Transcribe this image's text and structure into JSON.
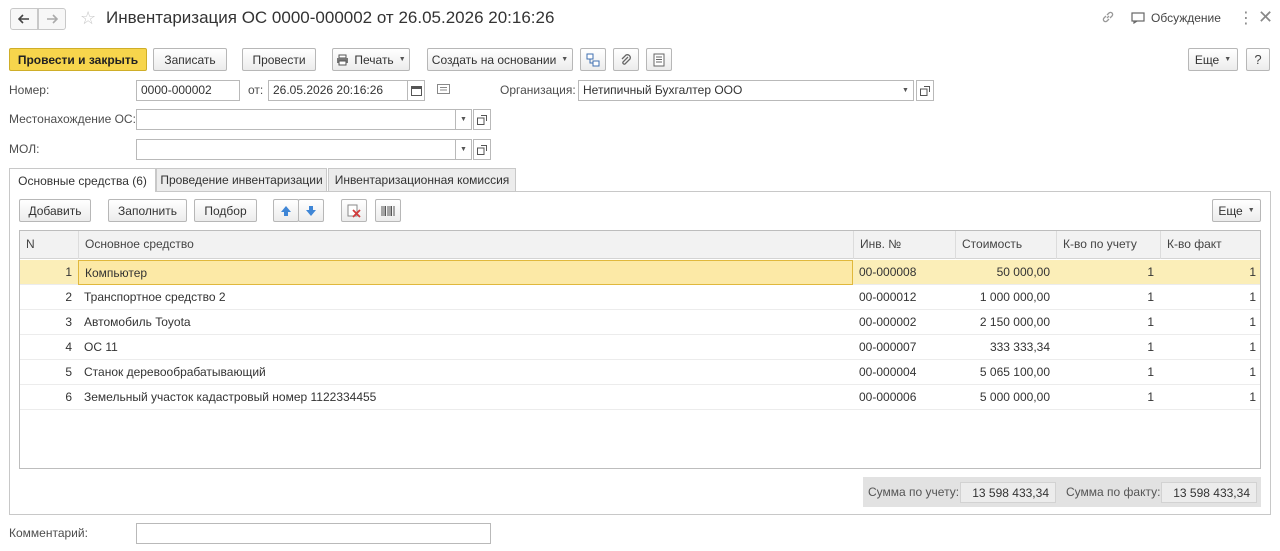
{
  "window": {
    "title": "Инвентаризация ОС 0000-000002 от 26.05.2026 20:16:26",
    "discussion_label": "Обсуждение"
  },
  "toolbar": {
    "post_and_close": "Провести и закрыть",
    "save": "Записать",
    "post": "Провести",
    "print": "Печать",
    "create_based_on": "Создать на основании",
    "more": "Еще"
  },
  "form": {
    "number_label": "Номер:",
    "number_value": "0000-000002",
    "date_label": "от:",
    "date_value": "26.05.2026 20:16:26",
    "organization_label": "Организация:",
    "organization_value": "Нетипичный Бухгалтер ООО",
    "location_label": "Местонахождение ОС:",
    "location_value": "",
    "mol_label": "МОЛ:",
    "mol_value": "",
    "comment_label": "Комментарий:",
    "comment_value": ""
  },
  "tabs": [
    {
      "label": "Основные средства (6)",
      "active": true
    },
    {
      "label": "Проведение инвентаризации",
      "active": false
    },
    {
      "label": "Инвентаризационная комиссия",
      "active": false
    }
  ],
  "table_toolbar": {
    "add": "Добавить",
    "fill": "Заполнить",
    "pick": "Подбор",
    "more": "Еще"
  },
  "table": {
    "columns": [
      "N",
      "Основное средство",
      "Инв. №",
      "Стоимость",
      "К-во по учету",
      "К-во факт"
    ],
    "rows": [
      {
        "n": "1",
        "asset": "Компьютер",
        "inv": "00-000008",
        "cost": "50 000,00",
        "qty_book": "1",
        "qty_fact": "1"
      },
      {
        "n": "2",
        "asset": "Транспортное средство 2",
        "inv": "00-000012",
        "cost": "1 000 000,00",
        "qty_book": "1",
        "qty_fact": "1"
      },
      {
        "n": "3",
        "asset": "Автомобиль Toyota",
        "inv": "00-000002",
        "cost": "2 150 000,00",
        "qty_book": "1",
        "qty_fact": "1"
      },
      {
        "n": "4",
        "asset": "ОС 11",
        "inv": "00-000007",
        "cost": "333 333,34",
        "qty_book": "1",
        "qty_fact": "1"
      },
      {
        "n": "5",
        "asset": "Станок деревообрабатывающий",
        "inv": "00-000004",
        "cost": "5 065 100,00",
        "qty_book": "1",
        "qty_fact": "1"
      },
      {
        "n": "6",
        "asset": "Земельный участок кадастровый номер 1122334455",
        "inv": "00-000006",
        "cost": "5 000 000,00",
        "qty_book": "1",
        "qty_fact": "1"
      }
    ]
  },
  "totals": {
    "book_label": "Сумма по учету:",
    "book_value": "13 598 433,34",
    "fact_label": "Сумма по факту:",
    "fact_value": "13 598 433,34"
  },
  "colors": {
    "primary_button": "#f7d54c",
    "selected_row": "#fbeeb8",
    "arrow_blue": "#3f86d6",
    "delete_red": "#d23b3b"
  }
}
